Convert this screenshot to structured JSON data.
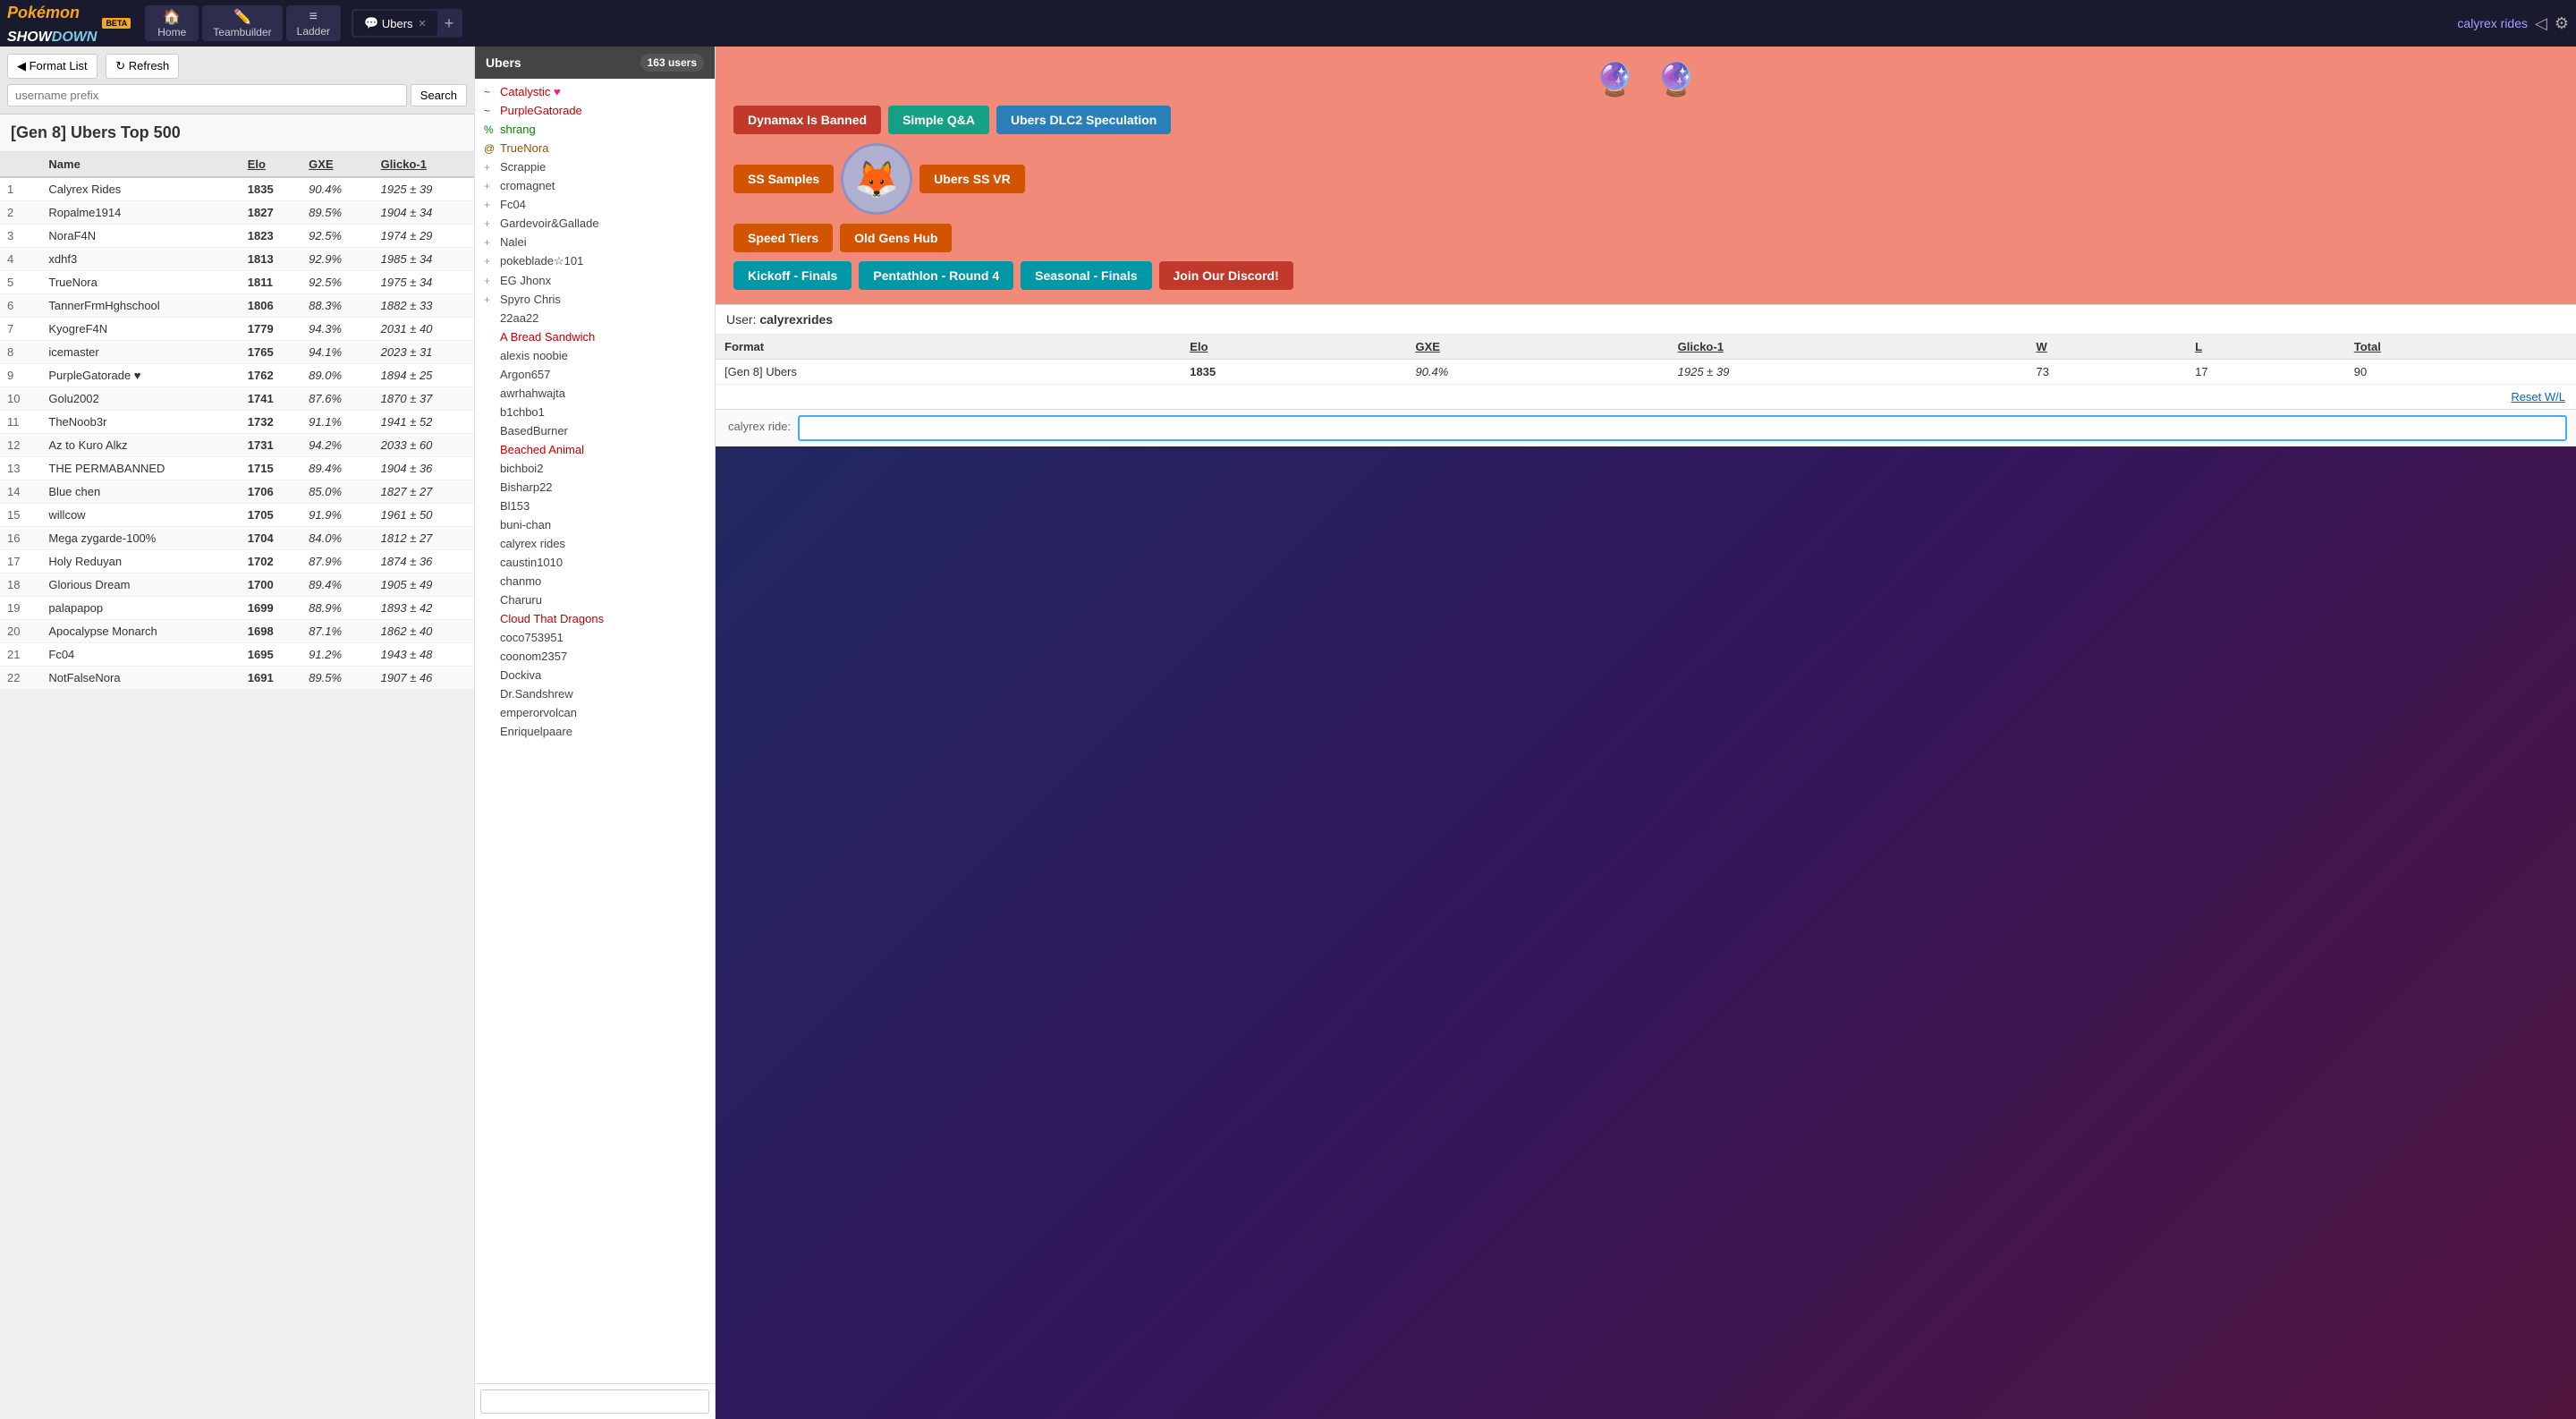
{
  "app": {
    "title": "Pokémon Showdown",
    "beta": "BETA"
  },
  "nav": {
    "home_label": "Home",
    "teambuilder_label": "Teambuilder",
    "ladder_label": "Ladder",
    "tab_ubers": "Ubers",
    "add_tab": "+",
    "username": "calyrex rides",
    "home_icon": "🏠",
    "teambuilder_icon": "✏️",
    "ladder_icon": "≡"
  },
  "left": {
    "format_list_label": "◀ Format List",
    "refresh_label": "↻ Refresh",
    "search_placeholder": "username prefix",
    "search_btn": "Search",
    "ladder_title": "[Gen 8] Ubers Top 500",
    "table_headers": [
      "",
      "Name",
      "Elo",
      "GXE",
      "Glicko-1"
    ],
    "rows": [
      {
        "rank": 1,
        "name": "Calyrex Rides",
        "elo": "1835",
        "gxe": "90.4%",
        "glicko": "1925 ± 39"
      },
      {
        "rank": 2,
        "name": "Ropalme1914",
        "elo": "1827",
        "gxe": "89.5%",
        "glicko": "1904 ± 34"
      },
      {
        "rank": 3,
        "name": "NoraF4N",
        "elo": "1823",
        "gxe": "92.5%",
        "glicko": "1974 ± 29"
      },
      {
        "rank": 4,
        "name": "xdhf3",
        "elo": "1813",
        "gxe": "92.9%",
        "glicko": "1985 ± 34"
      },
      {
        "rank": 5,
        "name": "TrueNora",
        "elo": "1811",
        "gxe": "92.5%",
        "glicko": "1975 ± 34"
      },
      {
        "rank": 6,
        "name": "TannerFrmHghschool",
        "elo": "1806",
        "gxe": "88.3%",
        "glicko": "1882 ± 33"
      },
      {
        "rank": 7,
        "name": "KyogreF4N",
        "elo": "1779",
        "gxe": "94.3%",
        "glicko": "2031 ± 40"
      },
      {
        "rank": 8,
        "name": "icemaster",
        "elo": "1765",
        "gxe": "94.1%",
        "glicko": "2023 ± 31"
      },
      {
        "rank": 9,
        "name": "PurpleGatorade ♥",
        "elo": "1762",
        "gxe": "89.0%",
        "glicko": "1894 ± 25"
      },
      {
        "rank": 10,
        "name": "Golu2002",
        "elo": "1741",
        "gxe": "87.6%",
        "glicko": "1870 ± 37"
      },
      {
        "rank": 11,
        "name": "TheNoob3r",
        "elo": "1732",
        "gxe": "91.1%",
        "glicko": "1941 ± 52"
      },
      {
        "rank": 12,
        "name": "Az to Kuro Alkz",
        "elo": "1731",
        "gxe": "94.2%",
        "glicko": "2033 ± 60"
      },
      {
        "rank": 13,
        "name": "THE PERMABANNED",
        "elo": "1715",
        "gxe": "89.4%",
        "glicko": "1904 ± 36"
      },
      {
        "rank": 14,
        "name": "Blue chen",
        "elo": "1706",
        "gxe": "85.0%",
        "glicko": "1827 ± 27"
      },
      {
        "rank": 15,
        "name": "willcow",
        "elo": "1705",
        "gxe": "91.9%",
        "glicko": "1961 ± 50"
      },
      {
        "rank": 16,
        "name": "Mega zygarde-100%",
        "elo": "1704",
        "gxe": "84.0%",
        "glicko": "1812 ± 27"
      },
      {
        "rank": 17,
        "name": "Holy Reduyan",
        "elo": "1702",
        "gxe": "87.9%",
        "glicko": "1874 ± 36"
      },
      {
        "rank": 18,
        "name": "Glorious Dream",
        "elo": "1700",
        "gxe": "89.4%",
        "glicko": "1905 ± 49"
      },
      {
        "rank": 19,
        "name": "palapapop",
        "elo": "1699",
        "gxe": "88.9%",
        "glicko": "1893 ± 42"
      },
      {
        "rank": 20,
        "name": "Apocalypse Monarch",
        "elo": "1698",
        "gxe": "87.1%",
        "glicko": "1862 ± 40"
      },
      {
        "rank": 21,
        "name": "Fc04",
        "elo": "1695",
        "gxe": "91.2%",
        "glicko": "1943 ± 48"
      },
      {
        "rank": 22,
        "name": "NotFalseNora",
        "elo": "1691",
        "gxe": "89.5%",
        "glicko": "1907 ± 46"
      }
    ]
  },
  "chat": {
    "header": "Ubers",
    "close_icon": "✕",
    "user_count": "163 users",
    "users": [
      {
        "name": "Catalystic",
        "rank": "high",
        "symbol": "~",
        "suffix": "♥"
      },
      {
        "name": "PurpleGatorade",
        "rank": "high",
        "symbol": "~",
        "suffix": ""
      },
      {
        "name": "shrang",
        "rank": "mod",
        "symbol": "%",
        "suffix": ""
      },
      {
        "name": "TrueNora",
        "rank": "driver",
        "symbol": "@",
        "suffix": ""
      },
      {
        "name": "Scrappie",
        "rank": "normal",
        "symbol": "+",
        "suffix": ""
      },
      {
        "name": "cromagnet",
        "rank": "normal",
        "symbol": "+",
        "suffix": ""
      },
      {
        "name": "Fc04",
        "rank": "normal",
        "symbol": "+",
        "suffix": ""
      },
      {
        "name": "Gardevoir&Gallade",
        "rank": "normal",
        "symbol": "+",
        "suffix": ""
      },
      {
        "name": "Nalei",
        "rank": "normal",
        "symbol": "+",
        "suffix": ""
      },
      {
        "name": "pokeblade☆101",
        "rank": "normal",
        "symbol": "+",
        "suffix": ""
      },
      {
        "name": "EG Jhonx",
        "rank": "normal",
        "symbol": "+",
        "suffix": ""
      },
      {
        "name": "Spyro Chris",
        "rank": "normal",
        "symbol": "+",
        "suffix": ""
      },
      {
        "name": "22aa22",
        "rank": "normal",
        "symbol": " ",
        "suffix": ""
      },
      {
        "name": "A Bread Sandwich",
        "rank": "orange",
        "symbol": " ",
        "suffix": ""
      },
      {
        "name": "alexis noobie",
        "rank": "normal",
        "symbol": " ",
        "suffix": ""
      },
      {
        "name": "Argon657",
        "rank": "normal",
        "symbol": " ",
        "suffix": ""
      },
      {
        "name": "awrhahwajta",
        "rank": "normal",
        "symbol": " ",
        "suffix": ""
      },
      {
        "name": "b1chbo1",
        "rank": "normal",
        "symbol": " ",
        "suffix": ""
      },
      {
        "name": "BasedBurner",
        "rank": "normal",
        "symbol": " ",
        "suffix": ""
      },
      {
        "name": "Beached Animal",
        "rank": "orange",
        "symbol": " ",
        "suffix": ""
      },
      {
        "name": "bichboi2",
        "rank": "normal",
        "symbol": " ",
        "suffix": ""
      },
      {
        "name": "Bisharp22",
        "rank": "normal",
        "symbol": " ",
        "suffix": ""
      },
      {
        "name": "Bl153",
        "rank": "normal",
        "symbol": " ",
        "suffix": ""
      },
      {
        "name": "buni-chan",
        "rank": "normal",
        "symbol": " ",
        "suffix": ""
      },
      {
        "name": "calyrex rides",
        "rank": "normal",
        "symbol": " ",
        "suffix": ""
      },
      {
        "name": "caustin1010",
        "rank": "normal",
        "symbol": " ",
        "suffix": ""
      },
      {
        "name": "chanmo",
        "rank": "normal",
        "symbol": " ",
        "suffix": ""
      },
      {
        "name": "Charuru",
        "rank": "normal",
        "symbol": " ",
        "suffix": ""
      },
      {
        "name": "Cloud That Dragons",
        "rank": "orange",
        "symbol": " ",
        "suffix": ""
      },
      {
        "name": "coco753951",
        "rank": "normal",
        "symbol": " ",
        "suffix": ""
      },
      {
        "name": "coonom2357",
        "rank": "normal",
        "symbol": " ",
        "suffix": ""
      },
      {
        "name": "Dockiva",
        "rank": "normal",
        "symbol": " ",
        "suffix": ""
      },
      {
        "name": "Dr.Sandshrew",
        "rank": "normal",
        "symbol": " ",
        "suffix": ""
      },
      {
        "name": "emperorvolcan",
        "rank": "normal",
        "symbol": " ",
        "suffix": ""
      },
      {
        "name": "Enriquelpaare",
        "rank": "normal",
        "symbol": " ",
        "suffix": ""
      }
    ],
    "input_placeholder": ""
  },
  "room": {
    "mascot_left": "🔮",
    "mascot_right": "🔮",
    "buttons": [
      {
        "label": "Dynamax Is Banned",
        "color": "btn-red"
      },
      {
        "label": "Simple Q&A",
        "color": "btn-teal"
      },
      {
        "label": "Ubers DLC2 Speculation",
        "color": "btn-blue"
      },
      {
        "label": "SS Samples",
        "color": "btn-orange"
      },
      {
        "label": "Ubers SS VR",
        "color": "btn-orange"
      },
      {
        "label": "Speed Tiers",
        "color": "btn-orange"
      },
      {
        "label": "Old Gens Hub",
        "color": "btn-orange"
      },
      {
        "label": "Kickoff - Finals",
        "color": "btn-cyan"
      },
      {
        "label": "Pentathlon - Round 4",
        "color": "btn-cyan"
      },
      {
        "label": "Seasonal - Finals",
        "color": "btn-cyan"
      },
      {
        "label": "Join Our Discord!",
        "color": "btn-red"
      }
    ]
  },
  "user_stats": {
    "label": "User:",
    "username": "calyrexrides",
    "table_headers": [
      "Format",
      "Elo",
      "GXE",
      "Glicko-1",
      "W",
      "L",
      "Total"
    ],
    "row": {
      "format": "[Gen 8] Ubers",
      "elo": "1835",
      "gxe": "90.4%",
      "glicko": "1925 ± 39",
      "w": "73",
      "l": "17",
      "total": "90"
    },
    "reset_link": "Reset W/L"
  },
  "bottom_chat": {
    "username_label": "calyrex ride:",
    "input_value": "",
    "input_placeholder": ""
  }
}
